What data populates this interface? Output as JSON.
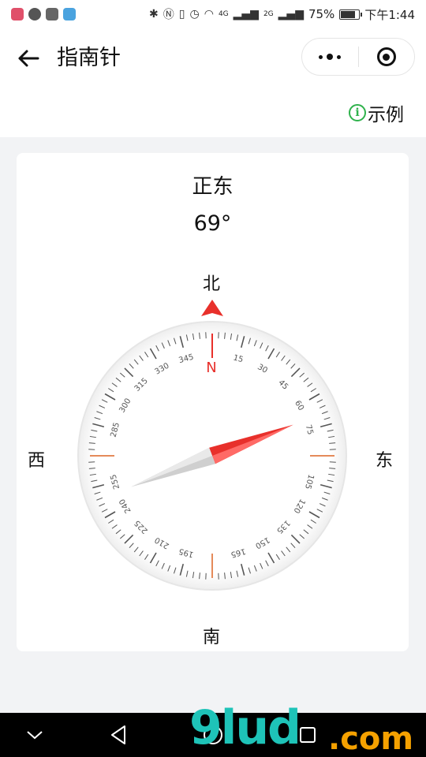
{
  "status_bar": {
    "battery": "75%",
    "time": "下午1:44",
    "network1": "4G",
    "network2": "2G",
    "icons": [
      "bluetooth-icon",
      "nfc-icon",
      "vibrate-icon",
      "alarm-icon",
      "wifi-icon",
      "signal-icon",
      "battery-icon"
    ]
  },
  "header": {
    "title": "指南针",
    "back_icon": "arrow-left-icon",
    "more_icon": "more-dots-icon",
    "close_icon": "target-icon"
  },
  "example": {
    "label": "示例",
    "icon": "info-icon",
    "color": "#2fb24c"
  },
  "compass": {
    "direction": "正东",
    "degree": "69°",
    "heading": 69,
    "north_label": "北",
    "south_label": "南",
    "west_label": "西",
    "east_label": "东",
    "dial_letter": "N",
    "dial_numbers": [
      "15",
      "30",
      "45",
      "60",
      "75",
      "105",
      "120",
      "135",
      "150",
      "165",
      "195",
      "210",
      "225",
      "240",
      "255",
      "285",
      "300",
      "315",
      "330",
      "345"
    ],
    "accent_color": "#e8302b",
    "marker_color": "#e58a5a"
  },
  "nav": {
    "icons": [
      "chevron-down-icon",
      "back-triangle-icon",
      "home-circle-icon",
      "recent-square-icon"
    ]
  },
  "watermark": {
    "main": "9lud",
    "sub": ".com"
  }
}
